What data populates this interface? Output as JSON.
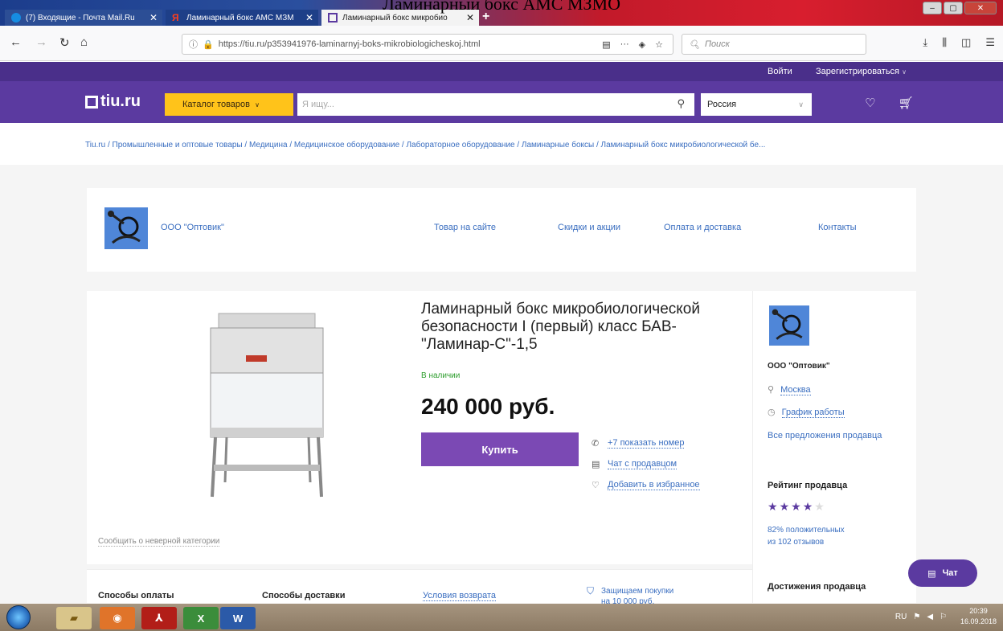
{
  "window": {
    "title": "Ламинарный бокс АМС МЗМО"
  },
  "tabs": [
    {
      "label": "(7) Входящие - Почта Mail.Ru",
      "color": "#168de2"
    },
    {
      "label": "Ламинарный бокс АМС МЗМ",
      "color": "#fc3f1d"
    },
    {
      "label": "Ламинарный бокс микробио",
      "color": "#5b3aa0"
    }
  ],
  "browser": {
    "url": "https://tiu.ru/p353941976-laminarnyj-boks-mikrobiologicheskoj.html",
    "search_placeholder": "Поиск",
    "more": "···"
  },
  "site": {
    "login": "Войти",
    "register": "Зарегистрироваться",
    "logo": "tiu.ru",
    "catalog": "Каталог товаров",
    "search_placeholder": "Я ищу...",
    "region": "Россия"
  },
  "breadcrumb": "Tiu.ru / Промышленные и оптовые товары / Медицина / Медицинское оборудование / Лабораторное оборудование / Ламинарные боксы / Ламинарный бокс микробиологической бе...",
  "seller_header": {
    "name": "ООО \"Оптовик\"",
    "nav": [
      "Товар на сайте",
      "Скидки и акции",
      "Оплата и доставка",
      "Контакты"
    ]
  },
  "product": {
    "title": "Ламинарный бокс микробиологической безопасности I (первый) класс БАВ-\"Ламинар-С\"-1,5",
    "stock": "В наличии",
    "price": "240 000 руб.",
    "buy": "Купить",
    "actions": [
      "+7 показать номер",
      "Чат с продавцом",
      "Добавить в избранное"
    ],
    "wrong_category": "Сообщить о неверной категории"
  },
  "seller_side": {
    "name": "ООО \"Оптовик\"",
    "city": "Москва",
    "schedule": "График работы",
    "all_offers": "Все предложения продавца",
    "rating_title": "Рейтинг продавца",
    "rating_stars": 4,
    "positive": "82% положительных",
    "reviews": "из 102 отзывов",
    "achievements": "Достижения продавца"
  },
  "bottom": {
    "payment": "Способы оплаты",
    "delivery": "Способы доставки",
    "returns": "Условия возврата",
    "protect_line1": "Защищаем покупки",
    "protect_line2": "на 10 000 руб."
  },
  "chat": "Чат",
  "taskbar": {
    "lang": "RU",
    "time": "20:39",
    "date": "16.09.2018"
  }
}
